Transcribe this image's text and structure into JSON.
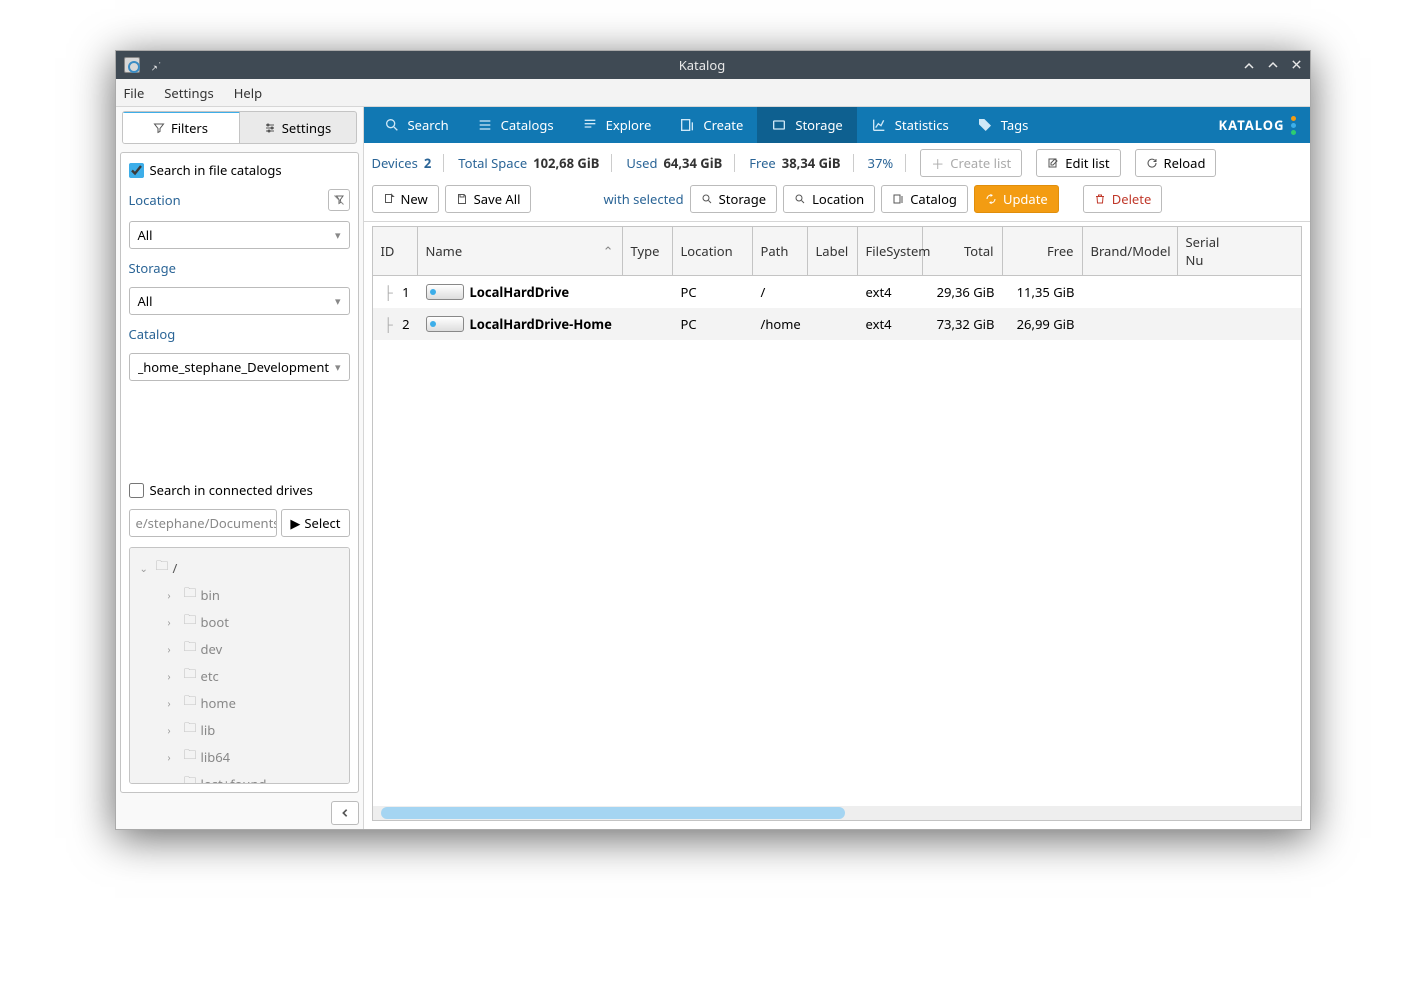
{
  "window": {
    "title": "Katalog"
  },
  "menu": {
    "file": "File",
    "settings": "Settings",
    "help": "Help"
  },
  "sidebar": {
    "tabs": {
      "filters": "Filters",
      "settings": "Settings"
    },
    "search_catalogs_label": "Search in file catalogs",
    "location_label": "Location",
    "storage_label": "Storage",
    "catalog_label": "Catalog",
    "location_value": "All",
    "storage_value": "All",
    "catalog_value": "_home_stephane_Development",
    "search_drives_label": "Search in connected drives",
    "drive_path": "e/stephane/Documents",
    "select_label": "Select",
    "tree_root": "/",
    "tree_items": [
      "bin",
      "boot",
      "dev",
      "etc",
      "home",
      "lib",
      "lib64",
      "lost+found"
    ]
  },
  "main_tabs": {
    "search": "Search",
    "catalogs": "Catalogs",
    "explore": "Explore",
    "create": "Create",
    "storage": "Storage",
    "statistics": "Statistics",
    "tags": "Tags",
    "brand": "KATALOG"
  },
  "stats": {
    "devices_label": "Devices",
    "devices_val": "2",
    "total_label": "Total Space",
    "total_val": "102,68 GiB",
    "used_label": "Used",
    "used_val": "64,34 GiB",
    "free_label": "Free",
    "free_val": "38,34 GiB",
    "percent": "37%",
    "create_list": "Create list",
    "edit_list": "Edit list",
    "reload": "Reload"
  },
  "actions": {
    "new": "New",
    "save_all": "Save All",
    "with_selected": "with selected",
    "storage": "Storage",
    "location": "Location",
    "catalog": "Catalog",
    "update": "Update",
    "delete": "Delete"
  },
  "table": {
    "headers": {
      "id": "ID",
      "name": "Name",
      "type": "Type",
      "location": "Location",
      "path": "Path",
      "label": "Label",
      "filesystem": "FileSystem",
      "total": "Total",
      "free": "Free",
      "brand": "Brand/Model",
      "serial": "Serial Nu"
    },
    "rows": [
      {
        "id": "1",
        "name": "LocalHardDrive",
        "type": "",
        "location": "PC",
        "path": "/",
        "label": "",
        "filesystem": "ext4",
        "total": "29,36 GiB",
        "free": "11,35 GiB"
      },
      {
        "id": "2",
        "name": "LocalHardDrive-Home",
        "type": "",
        "location": "PC",
        "path": "/home",
        "label": "",
        "filesystem": "ext4",
        "total": "73,32 GiB",
        "free": "26,99 GiB"
      }
    ]
  }
}
